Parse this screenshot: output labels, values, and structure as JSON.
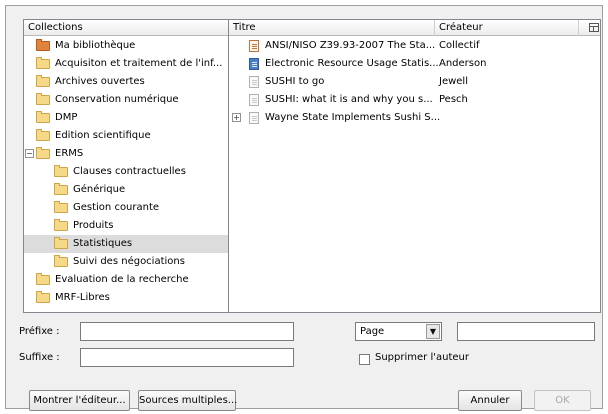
{
  "collections": {
    "header": "Collections",
    "items": [
      {
        "label": "Ma bibliothèque",
        "icon": "library-icon",
        "depth": 0
      },
      {
        "label": "Acquisiton et traitement de l'inf...",
        "icon": "folder-icon",
        "depth": 0
      },
      {
        "label": "Archives ouvertes",
        "icon": "folder-icon",
        "depth": 0
      },
      {
        "label": "Conservation numérique",
        "icon": "folder-icon",
        "depth": 0
      },
      {
        "label": "DMP",
        "icon": "folder-icon",
        "depth": 0
      },
      {
        "label": "Edition scientifique",
        "icon": "folder-icon",
        "depth": 0
      },
      {
        "label": "ERMS",
        "icon": "folder-icon",
        "depth": 0,
        "expanded": true
      },
      {
        "label": "Clauses contractuelles",
        "icon": "folder-icon",
        "depth": 1
      },
      {
        "label": "Générique",
        "icon": "folder-icon",
        "depth": 1
      },
      {
        "label": "Gestion courante",
        "icon": "folder-icon",
        "depth": 1
      },
      {
        "label": "Produits",
        "icon": "folder-icon",
        "depth": 1
      },
      {
        "label": "Statistiques",
        "icon": "folder-icon",
        "depth": 1,
        "selected": true
      },
      {
        "label": "Suivi des négociations",
        "icon": "folder-icon",
        "depth": 1
      },
      {
        "label": "Evaluation de la recherche",
        "icon": "folder-icon",
        "depth": 0
      },
      {
        "label": "MRF-Libres",
        "icon": "folder-icon",
        "depth": 0
      }
    ]
  },
  "items": {
    "col_title": "Titre",
    "col_creator": "Créateur",
    "rows": [
      {
        "title": "ANSI/NISO Z39.93-2007 The Sta...",
        "creator": "Collectif",
        "icon": "standard-document-icon"
      },
      {
        "title": "Electronic Resource Usage Statis...",
        "creator": "Anderson",
        "icon": "book-icon"
      },
      {
        "title": "SUSHI to go",
        "creator": "Jewell",
        "icon": "document-icon"
      },
      {
        "title": "SUSHI: what it is and why you s...",
        "creator": "Pesch",
        "icon": "document-icon"
      },
      {
        "title": "Wayne State Implements Sushi S...",
        "creator": "",
        "icon": "document-icon",
        "has_children": true
      }
    ]
  },
  "form": {
    "prefix_label": "Préfixe :",
    "prefix_value": "",
    "suffix_label": "Suffixe :",
    "suffix_value": "",
    "locator_selected": "Page",
    "locator_value": "",
    "suppress_author_label": "Supprimer l'auteur",
    "suppress_author_checked": false
  },
  "buttons": {
    "show_editor": "Montrer l'éditeur...",
    "multiple_sources": "Sources multiples...",
    "cancel": "Annuler",
    "ok": "OK"
  }
}
